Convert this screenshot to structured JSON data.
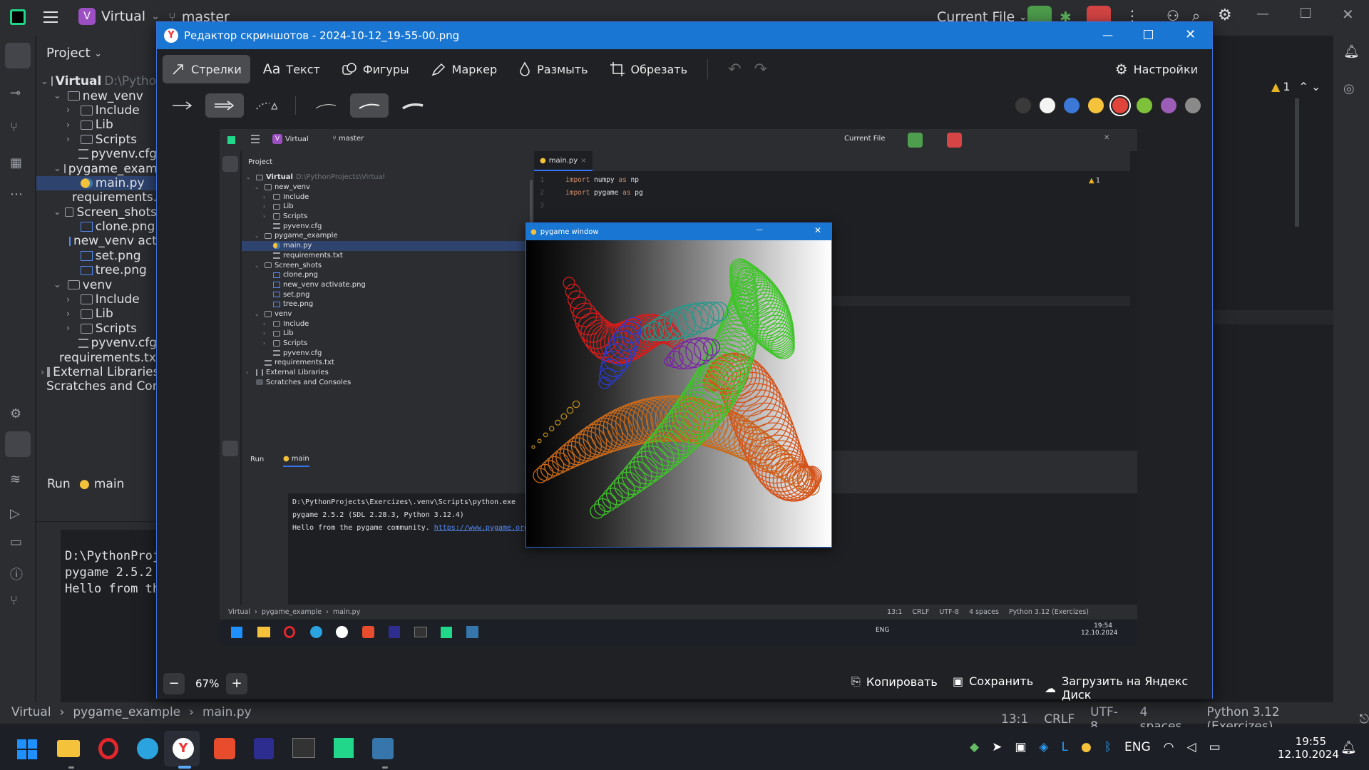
{
  "ide": {
    "project_initial": "V",
    "project_name": "Virtual",
    "branch": "master",
    "run_config": "Current File",
    "project_label": "Project",
    "tree": [
      {
        "label": "Virtual",
        "extra": "D:\\PythonProjects\\Virtual",
        "depth": 0,
        "type": "folder",
        "open": true
      },
      {
        "label": "new_venv",
        "depth": 1,
        "type": "folder",
        "open": true
      },
      {
        "label": "Include",
        "depth": 2,
        "type": "folder",
        "open": false
      },
      {
        "label": "Lib",
        "depth": 2,
        "type": "folder",
        "open": false
      },
      {
        "label": "Scripts",
        "depth": 2,
        "type": "folder",
        "open": false
      },
      {
        "label": "pyvenv.cfg",
        "depth": 2,
        "type": "file"
      },
      {
        "label": "pygame_example",
        "depth": 1,
        "type": "folder",
        "open": true
      },
      {
        "label": "main.py",
        "depth": 2,
        "type": "py",
        "selected": true
      },
      {
        "label": "requirements.txt",
        "depth": 2,
        "type": "file"
      },
      {
        "label": "Screen_shots",
        "depth": 1,
        "type": "folder",
        "open": true
      },
      {
        "label": "clone.png",
        "depth": 2,
        "type": "img"
      },
      {
        "label": "new_venv activate.png",
        "depth": 2,
        "type": "img"
      },
      {
        "label": "set.png",
        "depth": 2,
        "type": "img"
      },
      {
        "label": "tree.png",
        "depth": 2,
        "type": "img"
      },
      {
        "label": "venv",
        "depth": 1,
        "type": "folder",
        "open": true
      },
      {
        "label": "Include",
        "depth": 2,
        "type": "folder",
        "open": false
      },
      {
        "label": "Lib",
        "depth": 2,
        "type": "folder",
        "open": false
      },
      {
        "label": "Scripts",
        "depth": 2,
        "type": "folder",
        "open": false
      },
      {
        "label": "pyvenv.cfg",
        "depth": 2,
        "type": "file"
      },
      {
        "label": "requirements.txt",
        "depth": 1,
        "type": "file"
      },
      {
        "label": "External Libraries",
        "depth": 0,
        "type": "lib"
      },
      {
        "label": "Scratches and Consoles",
        "depth": 0,
        "type": "scratch"
      }
    ],
    "run_tab": "Run",
    "run_config_tab": "main",
    "console": [
      "D:\\PythonProjects\\Exercizes\\.venv\\Scripts\\python.exe",
      "pygame 2.5.2 (SDL 2.28.3, Python 3.12.4)",
      "Hello from the pygame community. "
    ],
    "console_link": "https://www.pygame.org/contribute.html",
    "editor_tab": "main.py",
    "code": [
      {
        "n": "1",
        "kw": "import",
        "rest": " numpy ",
        "kw2": "as",
        "rest2": " np"
      },
      {
        "n": "2",
        "kw": "import",
        "rest": " pygame ",
        "kw2": "as",
        "rest2": " pg"
      },
      {
        "n": "3",
        "kw": "",
        "rest": "",
        "kw2": "",
        "rest2": ""
      }
    ],
    "warnings": "1",
    "breadcrumbs": [
      "Virtual",
      "pygame_example",
      "main.py"
    ],
    "status": {
      "pos": "13:1",
      "eol": "CRLF",
      "enc": "UTF-8",
      "indent": "4 spaces",
      "interp": "Python 3.12 (Exercizes)"
    },
    "pygame_title": "pygame window"
  },
  "editor": {
    "title": "Редактор скриншотов - 2024-10-12_19-55-00.png",
    "tools": [
      {
        "label": "Стрелки",
        "icon": "arrow-icon",
        "active": true
      },
      {
        "label": "Текст",
        "icon": "text-icon",
        "active": false
      },
      {
        "label": "Фигуры",
        "icon": "shapes-icon",
        "active": false
      },
      {
        "label": "Маркер",
        "icon": "marker-icon",
        "active": false
      },
      {
        "label": "Размыть",
        "icon": "blur-icon",
        "active": false
      },
      {
        "label": "Обрезать",
        "icon": "crop-icon",
        "active": false
      }
    ],
    "settings": "Настройки",
    "colors": [
      "#3a3a3a",
      "#f4f4f4",
      "#3c78d8",
      "#f5c33b",
      "#e0443a",
      "#7ec13b",
      "#9b5db7",
      "#8a8a8a"
    ],
    "selected_color": "#e0443a",
    "zoom": "67%",
    "zoom_minus": "−",
    "zoom_plus": "+",
    "copy": "Копировать",
    "save": "Сохранить",
    "upload": "Загрузить на Яндекс Диск",
    "icons": {
      "aa": "Aa"
    }
  },
  "taskbar": {
    "lang": "ENG",
    "time": "19:55",
    "date": "12.10.2024",
    "mini_time": "19:54",
    "mini_date": "12.10.2024"
  }
}
